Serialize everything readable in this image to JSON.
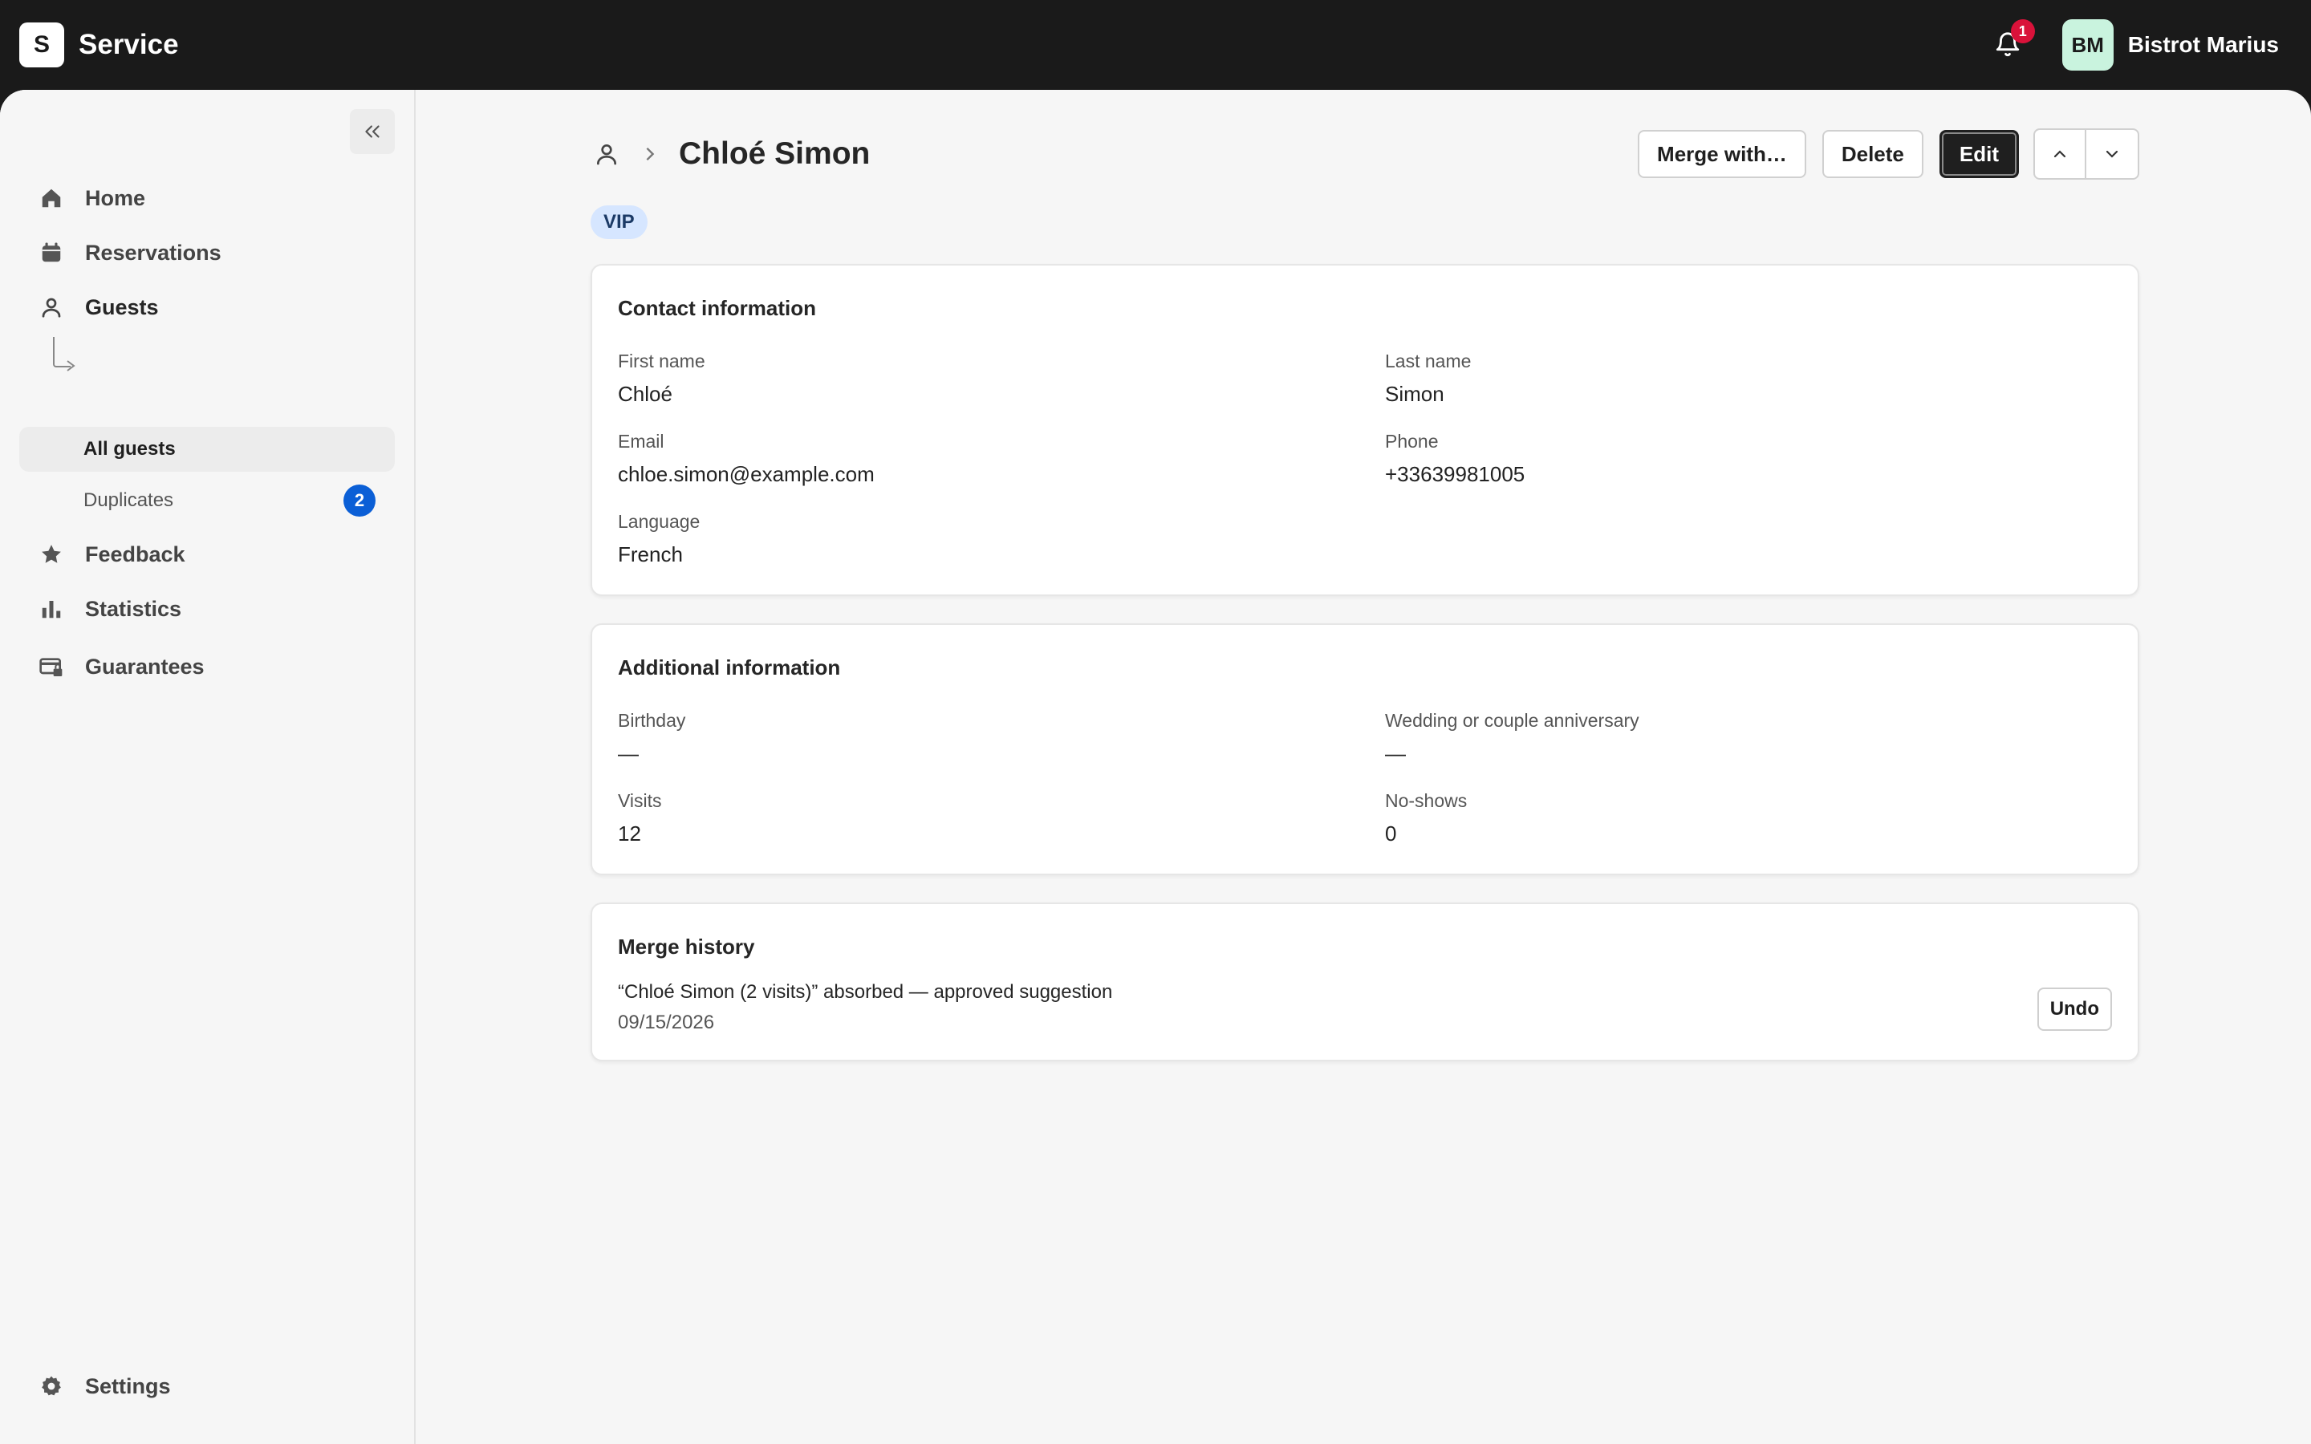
{
  "app": {
    "logo_letter": "S",
    "name": "Service"
  },
  "topbar": {
    "notifications_count": "1",
    "avatar_initials": "BM",
    "org_name": "Bistrot Marius",
    "avatar_color": "#c9f3de",
    "badge_color": "#d9123a"
  },
  "sidebar": {
    "items": [
      {
        "label": "Home",
        "icon": "home-icon"
      },
      {
        "label": "Reservations",
        "icon": "calendar-icon"
      },
      {
        "label": "Guests",
        "icon": "person-icon"
      },
      {
        "label": "Feedback",
        "icon": "star-icon"
      },
      {
        "label": "Statistics",
        "icon": "bar-chart-icon"
      },
      {
        "label": "Guarantees",
        "icon": "card-lock-icon"
      }
    ],
    "guests_sub": [
      {
        "label": "All guests",
        "active": true
      },
      {
        "label": "Duplicates",
        "count": "2"
      }
    ],
    "settings_label": "Settings"
  },
  "page": {
    "title": "Chloé Simon",
    "tag": "VIP",
    "actions": {
      "merge": "Merge with…",
      "delete": "Delete",
      "edit": "Edit"
    }
  },
  "contact": {
    "title": "Contact information",
    "first_name_label": "First name",
    "first_name": "Chloé",
    "last_name_label": "Last name",
    "last_name": "Simon",
    "email_label": "Email",
    "email": "chloe.simon@example.com",
    "phone_label": "Phone",
    "phone": "+33639981005",
    "language_label": "Language",
    "language": "French"
  },
  "additional": {
    "title": "Additional information",
    "birthday_label": "Birthday",
    "birthday": "—",
    "anniversary_label": "Wedding or couple anniversary",
    "anniversary": "—",
    "visits_label": "Visits",
    "visits": "12",
    "noshows_label": "No-shows",
    "noshows": "0"
  },
  "history": {
    "title": "Merge history",
    "entry_text": "“Chloé Simon (2 visits)” absorbed — approved suggestion",
    "entry_date": "09/15/2026",
    "undo_label": "Undo"
  },
  "colors": {
    "accent_blue": "#0b5fd6",
    "tag_bg": "#d6e6ff",
    "topbar": "#1a1a1a"
  }
}
